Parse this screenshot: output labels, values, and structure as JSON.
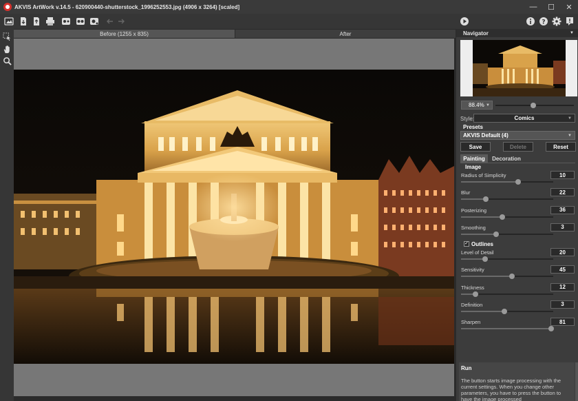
{
  "window": {
    "title": "AKVIS ArtWork v.14.5 - 620900440-shutterstock_1996252553.jpg (4906 x 3264) [scaled]",
    "minimize": "—",
    "maximize": "☐",
    "close": "✕"
  },
  "toolbar": {
    "icons": [
      "open-image-icon",
      "save-image-icon",
      "batch-icon",
      "print-icon",
      "share-icon",
      "settings-effect-icon",
      "preferences-icon",
      "undo-icon",
      "redo-icon",
      "run-icon",
      "info-icon",
      "help-icon",
      "gear-icon",
      "notification-icon"
    ]
  },
  "tabs": {
    "before": "Before (1255 x 835)",
    "after": "After"
  },
  "navigator": {
    "title": "Navigator",
    "zoom": "88.4%",
    "zoom_level": 0.48
  },
  "panel": {
    "style_label": "Style:",
    "style_value": "Comics",
    "presets_label": "Presets",
    "preset_value": "AKVIS Default (4)",
    "save_label": "Save",
    "delete_label": "Delete",
    "reset_label": "Reset",
    "tab_painting": "Painting",
    "tab_decoration": "Decoration",
    "image_section": "Image",
    "outlines_section": "Outlines",
    "outlines_checked": true,
    "image_params": [
      {
        "label": "Radius of Simplicity",
        "value": "10",
        "level": 0.62
      },
      {
        "label": "Blur",
        "value": "22",
        "level": 0.27
      },
      {
        "label": "Posterizing",
        "value": "36",
        "level": 0.45
      },
      {
        "label": "Smoothing",
        "value": "3",
        "level": 0.38
      }
    ],
    "outline_params": [
      {
        "label": "Level of Detail",
        "value": "20",
        "level": 0.26
      },
      {
        "label": "Sensitivity",
        "value": "45",
        "level": 0.55
      },
      {
        "label": "Thickness",
        "value": "12",
        "level": 0.16
      },
      {
        "label": "Definition",
        "value": "3",
        "level": 0.47
      },
      {
        "label": "Sharpen",
        "value": "81",
        "level": 0.98
      }
    ]
  },
  "help": {
    "title": "Run",
    "text": "The button starts image processing with the current settings. When you change other parameters, you have to press the button to have the image processed"
  }
}
